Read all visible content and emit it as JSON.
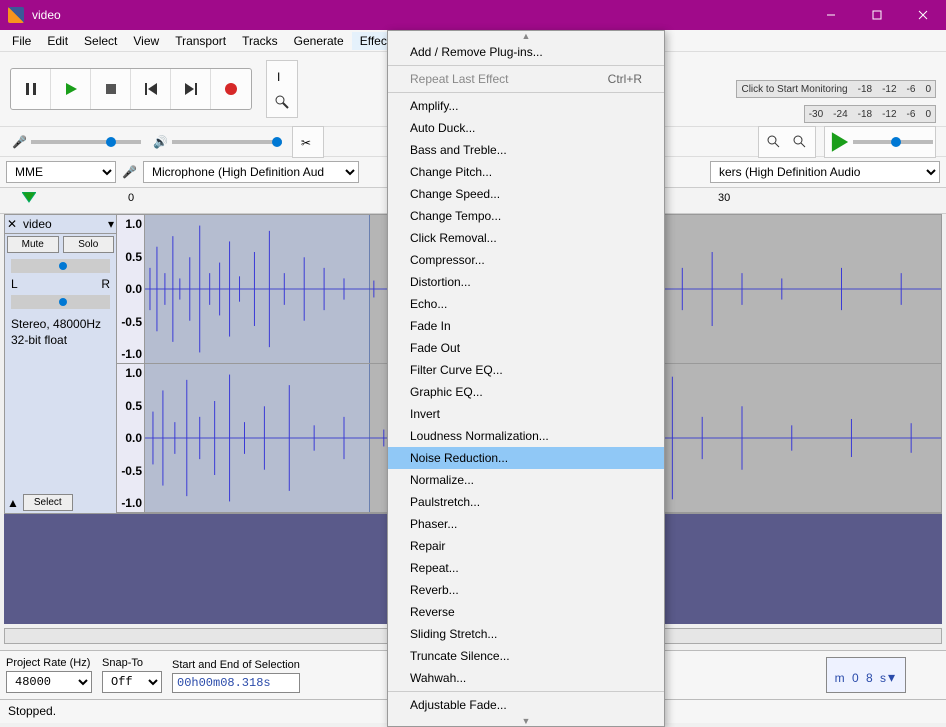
{
  "window": {
    "title": "video"
  },
  "menubar": [
    "File",
    "Edit",
    "Select",
    "View",
    "Transport",
    "Tracks",
    "Generate",
    "Effect"
  ],
  "transport_icons": [
    "pause",
    "play",
    "stop",
    "skip-start",
    "skip-end",
    "record"
  ],
  "meters": {
    "rec_label": "Click to Start Monitoring",
    "ticks": [
      "-18",
      "-12",
      "-6",
      "0"
    ],
    "play_ticks": [
      "-30",
      "-24",
      "-18",
      "-12",
      "-6",
      "0"
    ]
  },
  "device": {
    "host": "MME",
    "input": "Microphone (High Definition Aud",
    "output_suffix": "kers (High Definition Audio"
  },
  "timeline": {
    "t0": "0",
    "t1": "30"
  },
  "track": {
    "name": "video",
    "mute": "Mute",
    "solo": "Solo",
    "l": "L",
    "r": "R",
    "info1": "Stereo, 48000Hz",
    "info2": "32-bit float",
    "select": "Select",
    "yticks": [
      "1.0",
      "0.5",
      "0.0",
      "-0.5",
      "-1.0"
    ]
  },
  "status": {
    "rate_label": "Project Rate (Hz)",
    "rate": "48000",
    "snap_label": "Snap-To",
    "snap": "Off",
    "sel_label": "Start and End of Selection",
    "sel_val": "00h00m08.318s",
    "statusbar": "Stopped.",
    "big_time": "m 0 8 s"
  },
  "effect_menu": {
    "add_remove": "Add / Remove Plug-ins...",
    "repeat": "Repeat Last Effect",
    "repeat_accel": "Ctrl+R",
    "items": [
      "Amplify...",
      "Auto Duck...",
      "Bass and Treble...",
      "Change Pitch...",
      "Change Speed...",
      "Change Tempo...",
      "Click Removal...",
      "Compressor...",
      "Distortion...",
      "Echo...",
      "Fade In",
      "Fade Out",
      "Filter Curve EQ...",
      "Graphic EQ...",
      "Invert",
      "Loudness Normalization...",
      "Noise Reduction...",
      "Normalize...",
      "Paulstretch...",
      "Phaser...",
      "Repair",
      "Repeat...",
      "Reverb...",
      "Reverse",
      "Sliding Stretch...",
      "Truncate Silence...",
      "Wahwah..."
    ],
    "highlighted_index": 16,
    "adjustable": "Adjustable Fade..."
  }
}
